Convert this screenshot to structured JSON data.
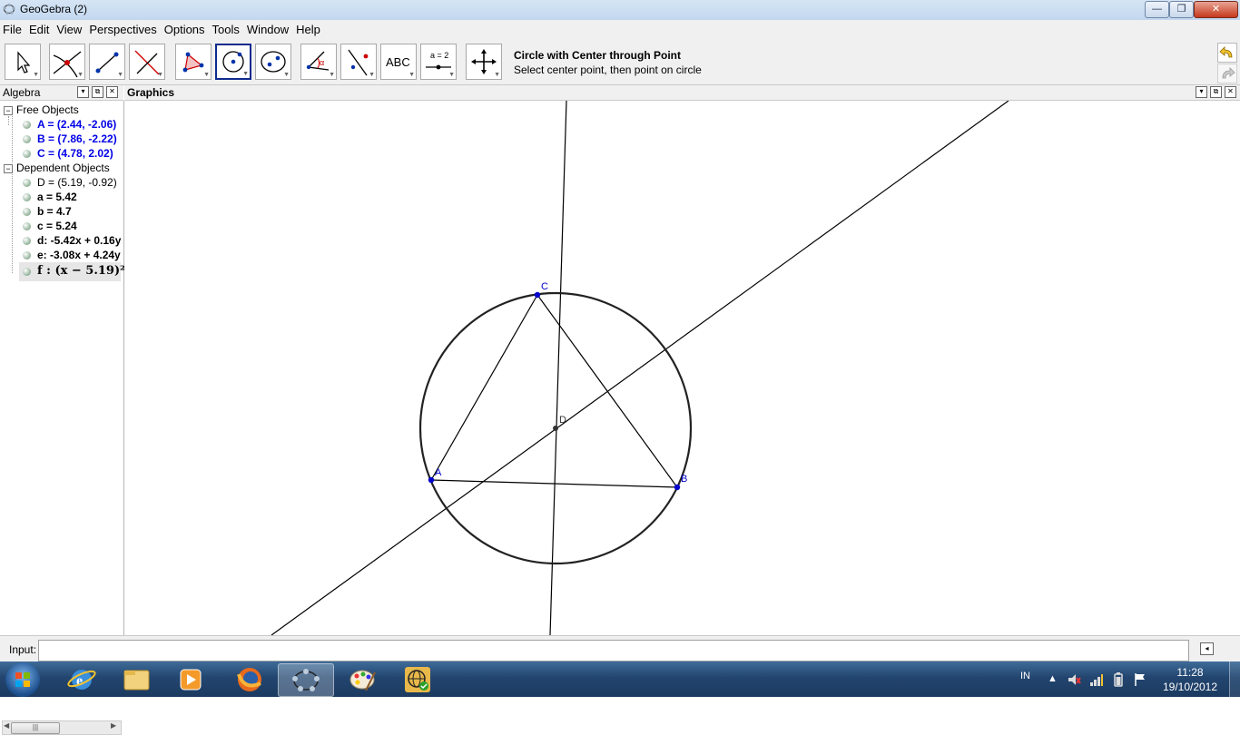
{
  "window": {
    "title": "GeoGebra (2)",
    "minimize": "—",
    "maximize": "❐",
    "close": "✕"
  },
  "menu": [
    "File",
    "Edit",
    "View",
    "Perspectives",
    "Options",
    "Tools",
    "Window",
    "Help"
  ],
  "toolbar": {
    "tool_name": "Circle with Center through Point",
    "tool_help": "Select center point, then point on circle",
    "text_tool_label": "ABC",
    "slider_tool_label": "a = 2"
  },
  "algebra": {
    "title": "Algebra",
    "free_label": "Free Objects",
    "dependent_label": "Dependent Objects",
    "free": [
      "A = (2.44, -2.06)",
      "B = (7.86, -2.22)",
      "C = (4.78, 2.02)"
    ],
    "dependent": [
      "D = (5.19, -0.92)",
      "a = 5.42",
      "b = 4.7",
      "c = 5.24",
      "d: -5.42x + 0.16y",
      "e: -3.08x + 4.24y",
      "f : (x − 5.19)²"
    ]
  },
  "graphics": {
    "title": "Graphics",
    "points": {
      "A": "A",
      "B": "B",
      "C": "C",
      "D": "D"
    }
  },
  "input": {
    "label": "Input:",
    "value": ""
  },
  "taskbar": {
    "language": "IN",
    "time": "11:28",
    "date": "19/10/2012"
  },
  "colors": {
    "free_objects": "#0000e6",
    "selected_tool_border": "#0d2a8e",
    "taskbar": "#22456f"
  }
}
